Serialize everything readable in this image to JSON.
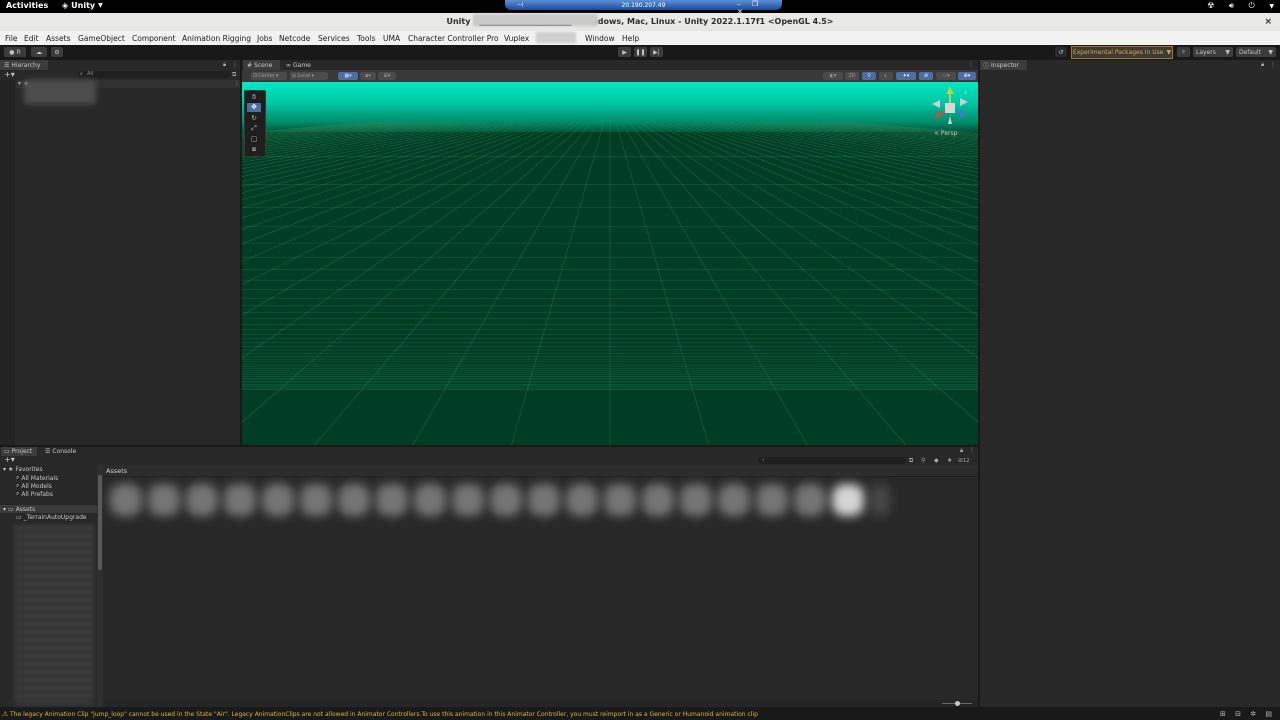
{
  "gnome": {
    "activities": "Activities",
    "app_name": "Unity",
    "rdp_ip": "20.190.207.49"
  },
  "window": {
    "title": "Unity - ███████████████ - Windows, Mac, Linux - Unity 2022.1.17f1 <OpenGL 4.5>",
    "close": "×"
  },
  "menu": {
    "items": [
      "File",
      "Edit",
      "Assets",
      "GameObject",
      "Component",
      "Animation Rigging",
      "Jobs",
      "Netcode",
      "Services",
      "Tools",
      "UMA",
      "Character Controller Pro",
      "Vuplex",
      "",
      "Window",
      "Help"
    ]
  },
  "toolbar": {
    "account_label": "R",
    "experimental_label": "Experimental Packages In Use",
    "layers_label": "Layers",
    "layout_label": "Default"
  },
  "hierarchy": {
    "tab": "Hierarchy",
    "search_placeholder": "All"
  },
  "scene": {
    "scene_tab": "Scene",
    "game_tab": "Game",
    "pivot": "Center",
    "space": "Local",
    "mode_2d": "2D",
    "persp_label": "< Persp"
  },
  "inspector": {
    "tab": "Inspector"
  },
  "project": {
    "project_tab": "Project",
    "console_tab": "Console",
    "favorites": "Favorites",
    "fav_items": [
      "All Materials",
      "All Models",
      "All Prefabs"
    ],
    "assets_root": "Assets",
    "first_folder": "_TerrainAutoUpgrade",
    "assets_path": "Assets",
    "hidden_count": "12"
  },
  "status": {
    "message": "The legacy Animation Clip \"jump_loop\" cannot be used in the State \"Air\". Legacy AnimationClips are not allowed in Animator Controllers.To use this animation in this Animator Controller, you must reimport in as a Generic or Humanoid animation clip"
  }
}
